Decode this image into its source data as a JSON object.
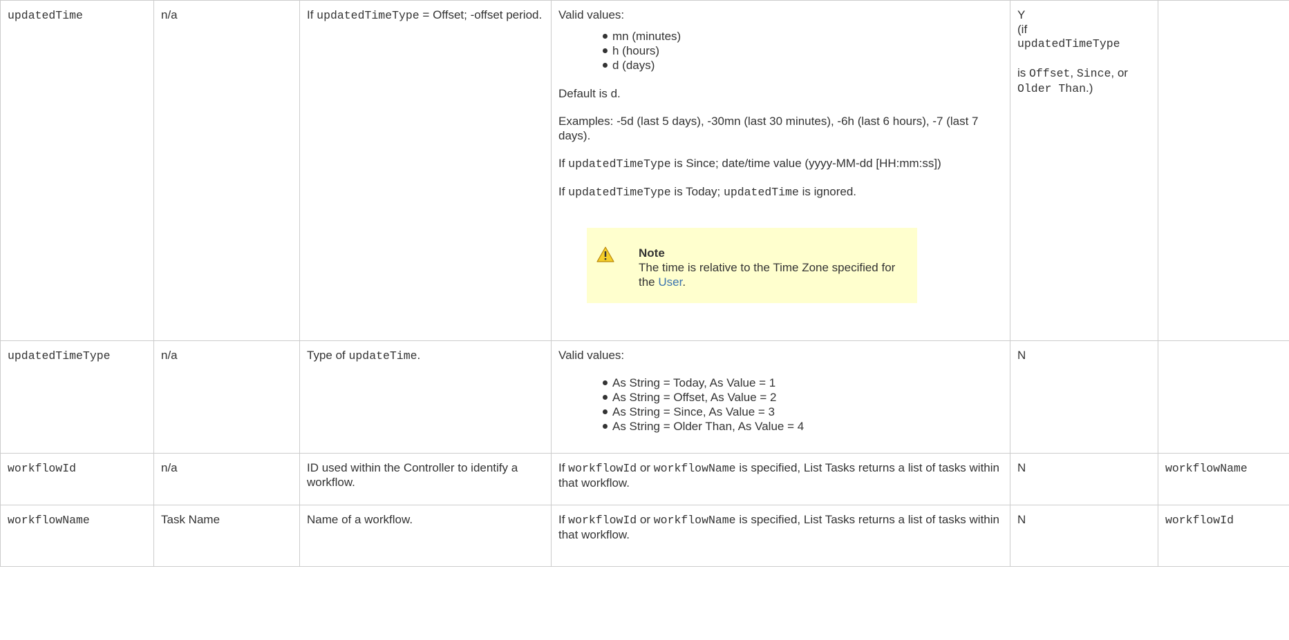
{
  "rows": {
    "updatedTime": {
      "name": "updatedTime",
      "ui_field": "n/a",
      "description_pre": "If ",
      "description_code": "updatedTimeType",
      "description_post": " = Offset; -offset period.",
      "valid_values_heading": "Valid values:",
      "valid_values": [
        "mn (minutes)",
        "h (hours)",
        "d (days)"
      ],
      "default_text": "Default is d.",
      "examples_text": "Examples: -5d (last 5 days), -30mn (last 30 minutes), -6h (last 6 hours), -7 (last 7 days).",
      "since_pre": "If ",
      "since_code": "updatedTimeType",
      "since_post": " is Since; date/time value (yyyy-MM-dd [HH:mm:ss])",
      "today_pre": "If ",
      "today_code1": "updatedTimeType",
      "today_mid": " is Today; ",
      "today_code2": "updatedTime",
      "today_post": " is ignored.",
      "note_title": "Note",
      "note_text": "The time is relative to the Time Zone specified for the ",
      "note_link": "User",
      "note_end": ".",
      "required_y": "Y",
      "required_if": "(if",
      "required_code": "updatedTimeType",
      "required_is": "is ",
      "required_offset": "Offset",
      "required_comma": ", ",
      "required_since": "Since",
      "required_or": ", or ",
      "required_older": "Older Than",
      "required_end": ".)",
      "mutually_exclusive": ""
    },
    "updatedTimeType": {
      "name": "updatedTimeType",
      "ui_field": "n/a",
      "description_pre": "Type of ",
      "description_code": "updateTime",
      "description_post": ".",
      "valid_values_heading": "Valid values:",
      "valid_values": [
        "As String = Today, As Value = 1",
        "As String = Offset, As Value = 2",
        "As String = Since, As Value = 3",
        "As String = Older Than, As Value = 4"
      ],
      "required": "N",
      "mutually_exclusive": ""
    },
    "workflowId": {
      "name": "workflowId",
      "ui_field": "n/a",
      "description": "ID used within the Controller to identify a workflow.",
      "spec_pre": "If ",
      "spec_code1": "workflowId",
      "spec_or": " or ",
      "spec_code2": "workflowName",
      "spec_post": " is specified, List Tasks returns a list of tasks within that workflow.",
      "required": "N",
      "mutually_exclusive": "workflowName"
    },
    "workflowName": {
      "name": "workflowName",
      "ui_field": "Task Name",
      "description": "Name of a workflow.",
      "spec_pre": "If ",
      "spec_code1": "workflowId",
      "spec_or": " or ",
      "spec_code2": "workflowName",
      "spec_post": " is specified, List Tasks returns a list of tasks within that workflow.",
      "required": "N",
      "mutually_exclusive": "workflowId"
    }
  },
  "colors": {
    "border": "#cccccc",
    "text": "#333333",
    "note_bg": "#ffffce",
    "link": "#3b73af",
    "warning_icon": "#f0c800"
  },
  "icons": {
    "note_icon": "warning-icon"
  }
}
